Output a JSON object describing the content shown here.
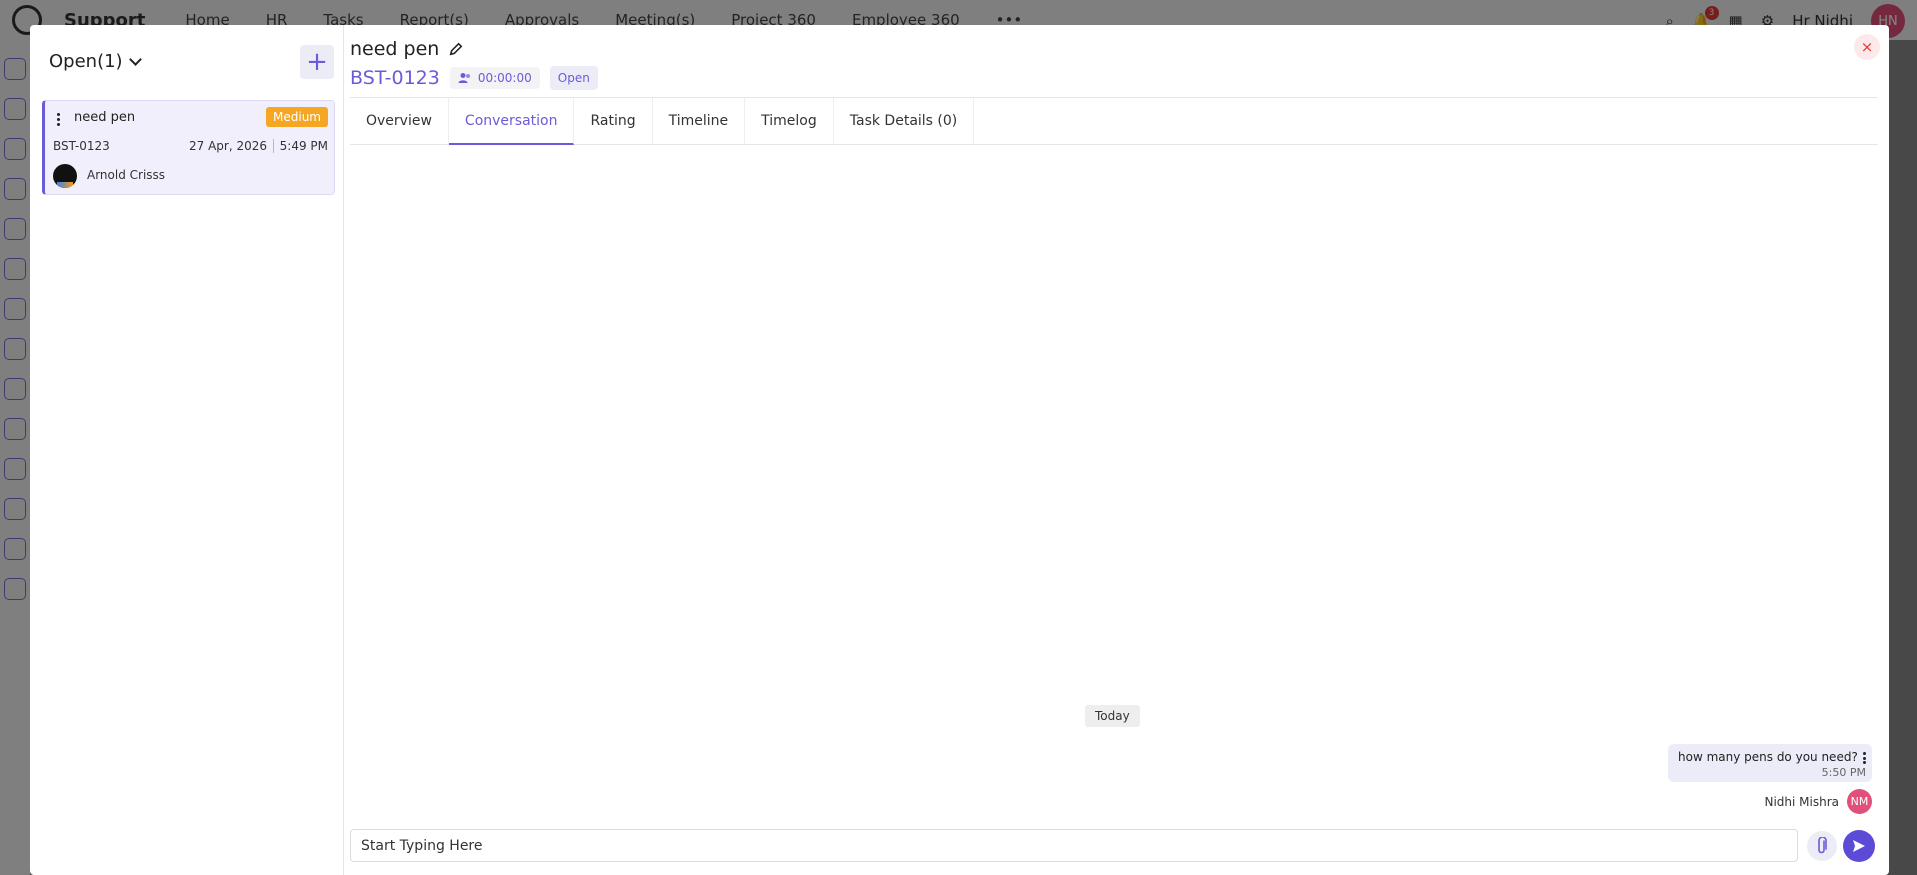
{
  "background": {
    "app_name": "Support",
    "nav": [
      "Home",
      "HR",
      "Tasks",
      "Report(s)",
      "Approvals",
      "Meeting(s)",
      "Project 360",
      "Employee 360"
    ],
    "more_icon": "more-horizontal-icon",
    "notification_count": "3",
    "user_name": "Hr Nidhi",
    "user_initials": "HN"
  },
  "left_panel": {
    "filter_label": "Open(1)",
    "add_label": "+",
    "tickets": [
      {
        "title": "need pen",
        "priority": "Medium",
        "id": "BST-0123",
        "date": "27 Apr, 2026",
        "time": "5:49 PM",
        "assignee": "Arnold Crisss"
      }
    ]
  },
  "ticket": {
    "title": "need pen",
    "id": "BST-0123",
    "timer": "00:00:00",
    "status": "Open",
    "close_label": "×"
  },
  "tabs": [
    {
      "label": "Overview"
    },
    {
      "label": "Conversation"
    },
    {
      "label": "Rating"
    },
    {
      "label": "Timeline"
    },
    {
      "label": "Timelog"
    },
    {
      "label": "Task Details (0)"
    }
  ],
  "conversation": {
    "day_label": "Today",
    "messages": [
      {
        "text": "how many pens do you need?",
        "time": "5:50 PM",
        "sender": "Nidhi Mishra",
        "initials": "NM"
      }
    ]
  },
  "composer": {
    "placeholder": "Start Typing Here"
  },
  "colors": {
    "accent": "#6a5cd8",
    "priority_medium": "#f5a623",
    "close": "#e53935",
    "avatar_pink": "#e0507a"
  }
}
